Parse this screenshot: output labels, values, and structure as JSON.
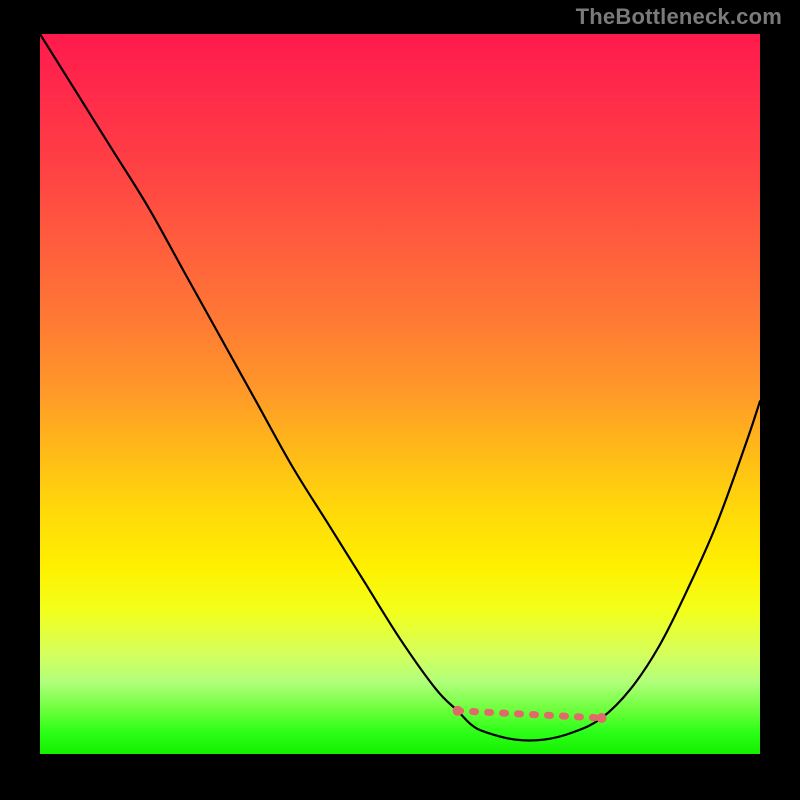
{
  "watermark": "TheBottleneck.com",
  "colors": {
    "page_bg": "#000000",
    "curve": "#000000",
    "dashed": "#e06a6a",
    "gradient_top": "#ff1a4d",
    "gradient_bottom": "#15f000"
  },
  "chart_data": {
    "type": "line",
    "title": "",
    "xlabel": "",
    "ylabel": "",
    "xlim": [
      0,
      100
    ],
    "ylim": [
      0,
      100
    ],
    "grid": false,
    "legend": false,
    "series": [
      {
        "name": "bottleneck-curve",
        "x": [
          0,
          5,
          10,
          15,
          20,
          25,
          30,
          35,
          40,
          45,
          50,
          55,
          58,
          60,
          62,
          66,
          70,
          74,
          78,
          82,
          86,
          90,
          94,
          98,
          100
        ],
        "y": [
          100,
          92,
          84,
          76,
          67,
          58,
          49,
          40,
          32,
          24,
          16,
          9,
          6,
          4,
          3,
          2,
          2,
          3,
          5,
          9,
          15,
          23,
          32,
          43,
          49
        ]
      }
    ],
    "annotations": [
      {
        "name": "dashed-floor-segment",
        "style": "dashed",
        "color": "#e06a6a",
        "x": [
          58,
          78
        ],
        "y": [
          6,
          5
        ]
      }
    ],
    "background_gradient": {
      "direction": "vertical",
      "stops": [
        {
          "pos": 0.0,
          "color": "#ff1a4d"
        },
        {
          "pos": 0.45,
          "color": "#ff8a2a"
        },
        {
          "pos": 0.72,
          "color": "#ffe600"
        },
        {
          "pos": 0.9,
          "color": "#b0ff7a"
        },
        {
          "pos": 1.0,
          "color": "#15f000"
        }
      ]
    }
  }
}
